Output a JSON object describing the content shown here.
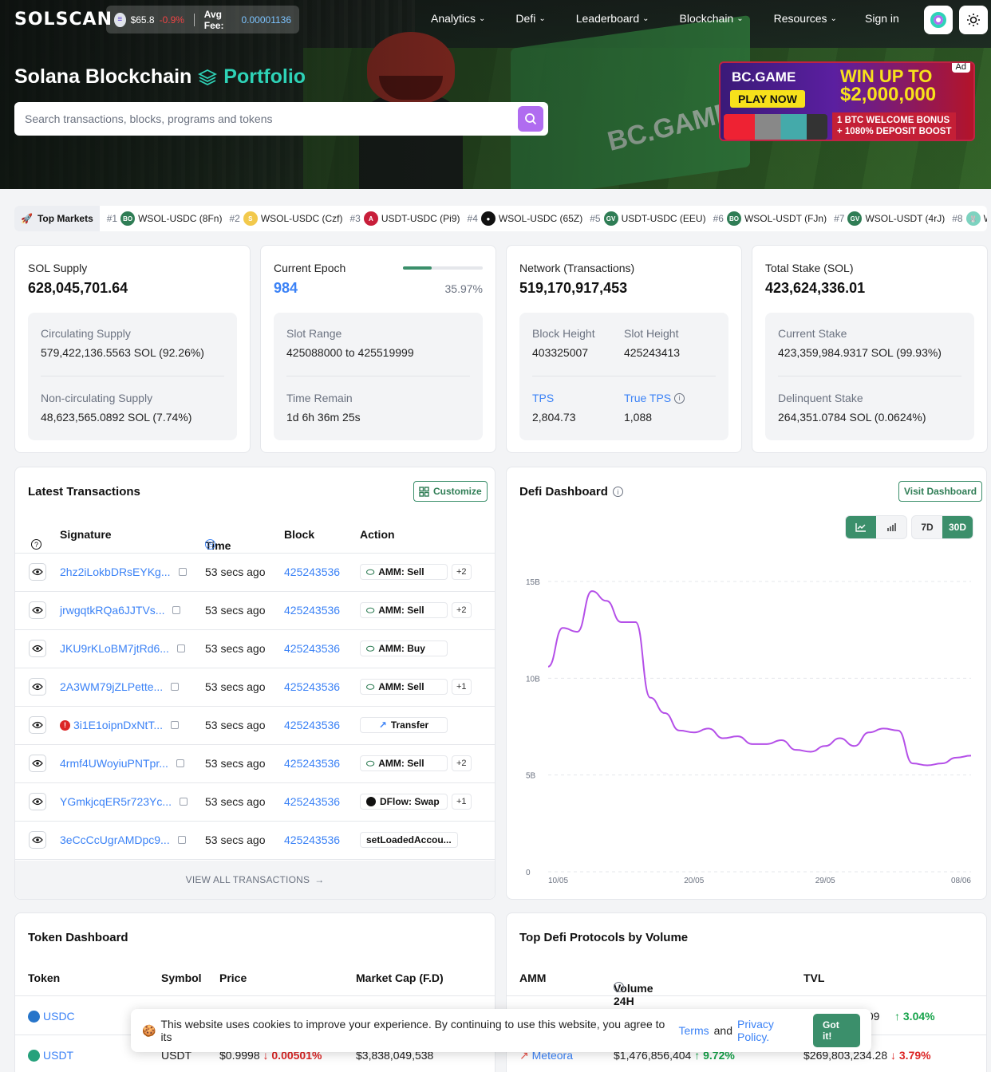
{
  "header": {
    "logo": "SOLSCAN",
    "sol_price": "$65.8",
    "sol_change": "-0.9%",
    "avg_fee_label": "Avg Fee:",
    "avg_fee_value": "0.00001136",
    "nav": [
      {
        "label": "Analytics"
      },
      {
        "label": "Defi"
      },
      {
        "label": "Leaderboard"
      },
      {
        "label": "Blockchain"
      },
      {
        "label": "Resources"
      }
    ],
    "signin": "Sign in"
  },
  "hero": {
    "title": "Solana Blockchain",
    "portfolio": "Portfolio",
    "search_placeholder": "Search transactions, blocks, programs and tokens"
  },
  "ad": {
    "tag": "Ad",
    "brand": "BC.GAME",
    "cta": "PLAY NOW",
    "headline1": "WIN UP TO",
    "headline2": "$2,000,000",
    "bonus1": "1 BTC WELCOME BONUS",
    "bonus2": "+ 1080% DEPOSIT BOOST"
  },
  "markets": {
    "label": "Top Markets",
    "items": [
      {
        "rank": "#1",
        "pair": "WSOL-USDC (8Fn)",
        "icon": "BO",
        "color": "#2f7d55"
      },
      {
        "rank": "#2",
        "pair": "WSOL-USDC (Czf)",
        "icon": "S",
        "color": "#f2c94c"
      },
      {
        "rank": "#3",
        "pair": "USDT-USDC (Pi9)",
        "icon": "A",
        "color": "#c81e3a"
      },
      {
        "rank": "#4",
        "pair": "WSOL-USDC (65Z)",
        "icon": "●",
        "color": "#111111"
      },
      {
        "rank": "#5",
        "pair": "USDT-USDC (EEU)",
        "icon": "GV",
        "color": "#2f7d55"
      },
      {
        "rank": "#6",
        "pair": "WSOL-USDT (FJn)",
        "icon": "BO",
        "color": "#2f7d55"
      },
      {
        "rank": "#7",
        "pair": "WSOL-USDT (4rJ)",
        "icon": "GV",
        "color": "#2f7d55"
      },
      {
        "rank": "#8",
        "pair": "WSOL",
        "icon": "🐰",
        "color": "#7dd3c0"
      }
    ]
  },
  "stats": {
    "supply": {
      "label": "SOL Supply",
      "value": "628,045,701.64",
      "circ_label": "Circulating Supply",
      "circ_value": "579,422,136.5563 SOL (92.26%)",
      "noncirc_label": "Non-circulating Supply",
      "noncirc_value": "48,623,565.0892 SOL (7.74%)"
    },
    "epoch": {
      "label": "Current Epoch",
      "value": "984",
      "progress": 0.3597,
      "pct": "35.97%",
      "slot_range_label": "Slot Range",
      "slot_range": "425088000 to 425519999",
      "time_label": "Time Remain",
      "time_value": "1d 6h 36m 25s"
    },
    "network": {
      "label": "Network (Transactions)",
      "value": "519,170,917,453",
      "bh_label": "Block Height",
      "bh_value": "403325007",
      "sh_label": "Slot Height",
      "sh_value": "425243413",
      "tps_label": "TPS",
      "tps_value": "2,804.73",
      "true_tps_label": "True TPS",
      "true_tps_value": "1,088"
    },
    "stake": {
      "label": "Total Stake (SOL)",
      "value": "423,624,336.01",
      "cur_label": "Current Stake",
      "cur_value": "423,359,984.9317 SOL (99.93%)",
      "del_label": "Delinquent Stake",
      "del_value": "264,351.0784 SOL (0.0624%)"
    }
  },
  "transactions": {
    "title": "Latest Transactions",
    "customize": "Customize",
    "headers": {
      "signature": "Signature",
      "time": "Time",
      "block": "Block",
      "action": "Action"
    },
    "rows": [
      {
        "sig": "2hz2iLokbDRsEYKg...",
        "time": "53 secs ago",
        "block": "425243536",
        "action": "AMM: Sell",
        "more": "+2",
        "err": false
      },
      {
        "sig": "jrwgqtkRQa6JJTVs...",
        "time": "53 secs ago",
        "block": "425243536",
        "action": "AMM: Sell",
        "more": "+2",
        "err": false
      },
      {
        "sig": "JKU9rKLoBM7jtRd6...",
        "time": "53 secs ago",
        "block": "425243536",
        "action": "AMM: Buy",
        "more": "",
        "err": false
      },
      {
        "sig": "2A3WM79jZLPette...",
        "time": "53 secs ago",
        "block": "425243536",
        "action": "AMM: Sell",
        "more": "+1",
        "err": false
      },
      {
        "sig": "3i1E1oipnDxNtT...",
        "time": "53 secs ago",
        "block": "425243536",
        "action": "Transfer",
        "more": "",
        "err": true
      },
      {
        "sig": "4rmf4UWoyiuPNTpr...",
        "time": "53 secs ago",
        "block": "425243536",
        "action": "AMM: Sell",
        "more": "+2",
        "err": false
      },
      {
        "sig": "YGmkjcqER5r723Yc...",
        "time": "53 secs ago",
        "block": "425243536",
        "action": "DFlow: Swap",
        "more": "+1",
        "err": false
      },
      {
        "sig": "3eCcCcUgrAMDpc9...",
        "time": "53 secs ago",
        "block": "425243536",
        "action": "setLoadedAccou...",
        "more": "",
        "err": false
      }
    ],
    "view_all": "VIEW ALL TRANSACTIONS"
  },
  "defi": {
    "title": "Defi Dashboard",
    "visit": "Visit Dashboard",
    "range": [
      "7D",
      "30D"
    ],
    "active_range": "30D"
  },
  "chart_data": {
    "type": "line",
    "x": [
      "10/05",
      "11/05",
      "12/05",
      "13/05",
      "14/05",
      "15/05",
      "16/05",
      "17/05",
      "18/05",
      "19/05",
      "20/05",
      "21/05",
      "22/05",
      "23/05",
      "24/05",
      "25/05",
      "26/05",
      "27/05",
      "28/05",
      "29/05",
      "30/05",
      "31/05",
      "01/06",
      "02/06",
      "03/06",
      "04/06",
      "05/06",
      "06/06",
      "07/06",
      "08/06"
    ],
    "values": [
      10.6,
      12.6,
      12.4,
      14.5,
      14.0,
      12.9,
      12.9,
      9.0,
      8.2,
      7.3,
      7.2,
      7.4,
      6.9,
      7.0,
      6.6,
      6.6,
      6.8,
      6.3,
      6.2,
      6.5,
      6.9,
      6.5,
      7.2,
      7.4,
      7.3,
      5.6,
      5.5,
      5.6,
      5.9,
      6.0
    ],
    "yticks": [
      "0",
      "5B",
      "10B",
      "15B"
    ],
    "xticks": [
      "10/05",
      "20/05",
      "29/05",
      "08/06"
    ],
    "ylim": [
      0,
      15
    ],
    "unit": "B",
    "grid": true,
    "color": "#b44fe8"
  },
  "tokens": {
    "title": "Token Dashboard",
    "headers": {
      "token": "Token",
      "symbol": "Symbol",
      "price": "Price",
      "mcap": "Market Cap (F.D)"
    },
    "rows": [
      {
        "name": "USDC",
        "symbol": "",
        "price": "",
        "change": "",
        "mcap": "",
        "color": "#2775ca"
      },
      {
        "name": "USDT",
        "symbol": "USDT",
        "price": "$0.9998",
        "change": "0.00501%",
        "mcap": "$3,838,049,538",
        "color": "#26a17b"
      }
    ]
  },
  "protocols": {
    "title": "Top Defi Protocols by Volume",
    "headers": {
      "amm": "AMM",
      "volume": "Volume 24H",
      "tvl": "TVL"
    },
    "rows": [
      {
        "name": "",
        "volume": "",
        "vol_change": "",
        "tvl": ".09",
        "tvl_change": "3.04%",
        "tvl_dir": "up"
      },
      {
        "name": "Meteora",
        "volume": "$1,476,856,404",
        "vol_change": "9.72%",
        "tvl": "$269,803,234.28",
        "tvl_change": "3.79%",
        "tvl_dir": "down"
      }
    ]
  },
  "cookie": {
    "text": "This website uses cookies to improve your experience. By continuing to use this website, you agree to its",
    "terms": "Terms",
    "and": "and",
    "privacy": "Privacy Policy.",
    "button": "Got it!"
  }
}
